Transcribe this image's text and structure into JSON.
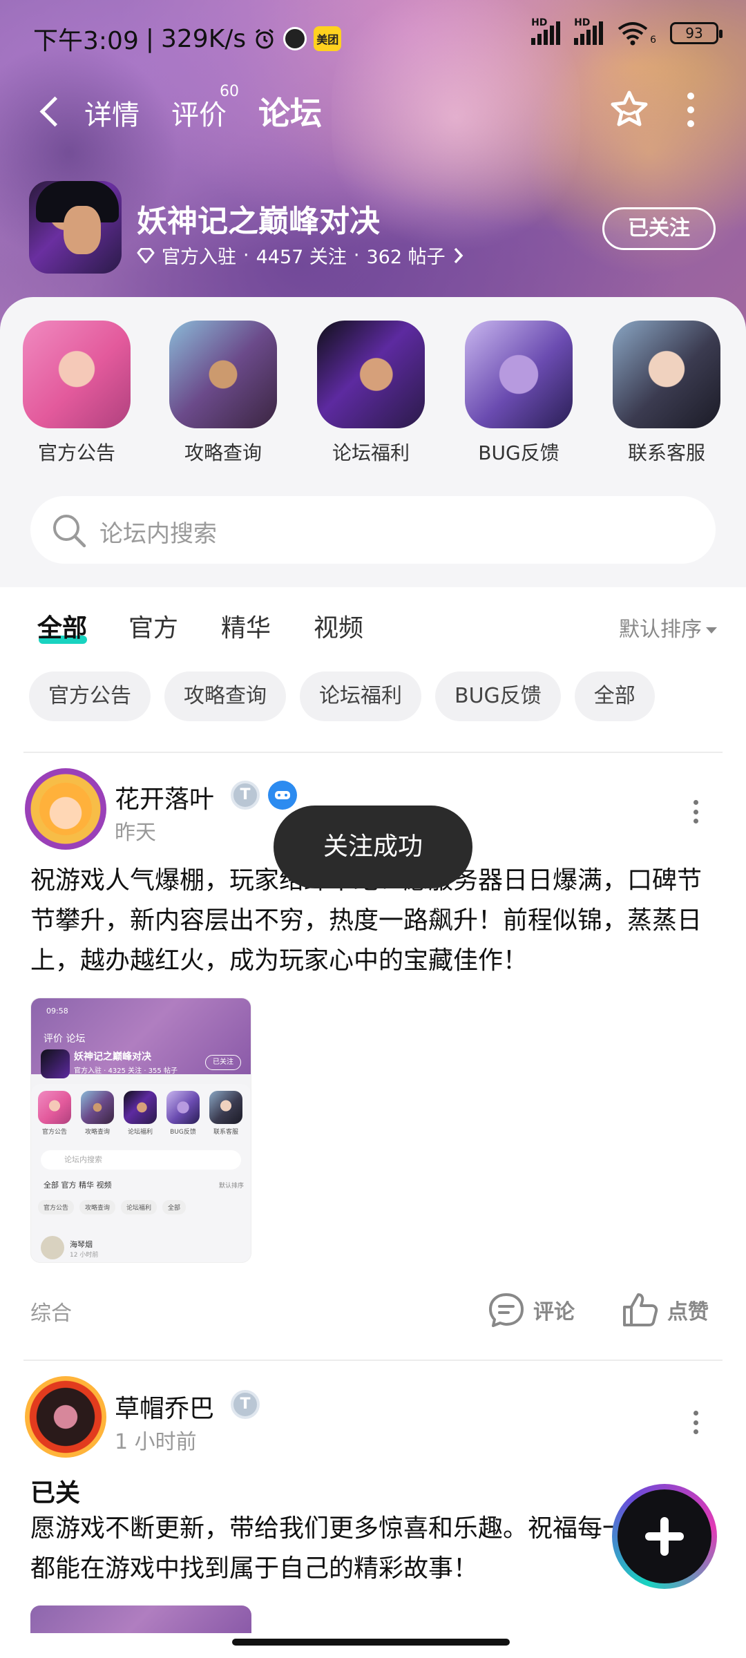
{
  "status_bar": {
    "time": "下午3:09",
    "net_speed": "329K/s",
    "meituan_label": "美团",
    "hd_label": "HD",
    "wifi_label": "6",
    "battery": "93"
  },
  "nav": {
    "tabs": [
      {
        "label": "详情"
      },
      {
        "label": "评价",
        "count": "60"
      },
      {
        "label": "论坛"
      }
    ],
    "active_tab": "论坛"
  },
  "game": {
    "title": "妖神记之巅峰对决",
    "official_label": "官方入驻",
    "followers": "4457 关注",
    "posts": "362 帖子",
    "separator": "·",
    "follow_state": "已关注"
  },
  "shortcuts": [
    {
      "label": "官方公告"
    },
    {
      "label": "攻略查询"
    },
    {
      "label": "论坛福利"
    },
    {
      "label": "BUG反馈"
    },
    {
      "label": "联系客服"
    }
  ],
  "search": {
    "placeholder": "论坛内搜索"
  },
  "filter_tabs": [
    {
      "label": "全部"
    },
    {
      "label": "官方"
    },
    {
      "label": "精华"
    },
    {
      "label": "视频"
    }
  ],
  "active_filter": "全部",
  "sort_label": "默认排序",
  "chips": [
    "官方公告",
    "攻略查询",
    "论坛福利",
    "BUG反馈",
    "全部"
  ],
  "posts": [
    {
      "username": "花开落叶",
      "time": "昨天",
      "level_badge": "T",
      "body": "祝游戏人气爆棚，玩家络绎不绝！愿服务器日日爆满，口碑节节攀升，新内容层出不穷，热度一路飙升！前程似锦，蒸蒸日上，越办越红火，成为玩家心中的宝藏佳作！",
      "tag": "综合",
      "comment_label": "评论",
      "like_label": "点赞",
      "thumbnail": {
        "time": "09:58",
        "tabs": "评价  论坛",
        "title": "妖神记之巅峰对决",
        "meta": "官方入驻 · 4325 关注 · 355 帖子",
        "follow": "已关注",
        "shortcuts": [
          "官方公告",
          "攻略查询",
          "论坛福利",
          "BUG反馈",
          "联系客服"
        ],
        "search": "论坛内搜索",
        "ftabs": "全部   官方   精华   视频",
        "sort": "默认排序",
        "chips": [
          "官方公告",
          "攻略查询",
          "论坛福利",
          "全部"
        ],
        "post_user": "海琴烟",
        "post_time": "12 小时前"
      }
    },
    {
      "username": "草帽乔巴",
      "time": "1 小时前",
      "level_badge": "T",
      "title": "已关",
      "body": "愿游戏不断更新，带给我们更多惊喜和乐趣。祝福每一位玩家都能在游戏中找到属于自己的精彩故事！"
    }
  ],
  "toast": "关注成功",
  "colors": {
    "accent": "#18d3c0",
    "header_purple": "#8d66ad",
    "toast_bg": "#2b2b2b"
  }
}
